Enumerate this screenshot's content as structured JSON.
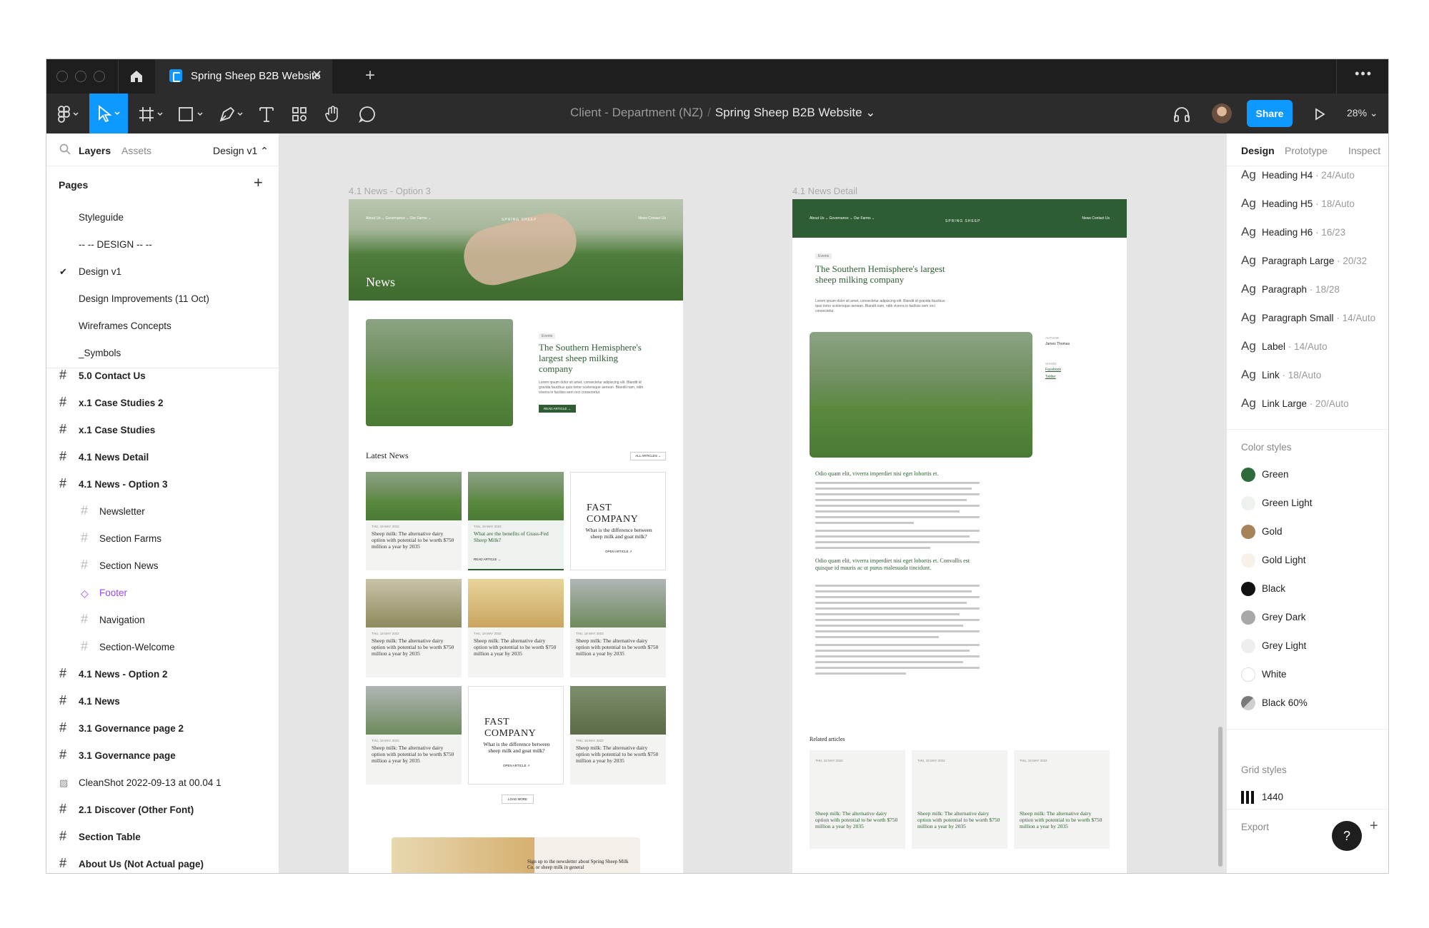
{
  "tabbar": {
    "file_tab": "Spring Sheep B2B Website",
    "close": "✕",
    "new_tab": "+",
    "more": "•••"
  },
  "toolbar": {
    "breadcrumb_team": "Client - Department (NZ)",
    "breadcrumb_sep": "/",
    "breadcrumb_file": "Spring Sheep B2B Website ⌄",
    "share": "Share",
    "zoom": "28% ⌄"
  },
  "left": {
    "tab_layers": "Layers",
    "tab_assets": "Assets",
    "page_selector": "Design v1 ⌃",
    "pages_title": "Pages",
    "pages": [
      "Styleguide",
      "-- -- DESIGN -- --",
      "Design v1",
      "Design Improvements (11 Oct)",
      "Wireframes Concepts",
      "_Symbols"
    ],
    "layers": [
      "5.0 Contact Us",
      "x.1 Case Studies 2",
      "x.1 Case Studies",
      "4.1 News Detail",
      "4.1 News - Option 3",
      "Newsletter",
      "Section Farms",
      "Section News",
      "Footer",
      "Navigation",
      "Section-Welcome",
      "4.1 News - Option 2",
      "4.1 News",
      "3.1 Governance page 2",
      "3.1 Governance page",
      "CleanShot 2022-09-13 at 00.04 1",
      "2.1 Discover (Other Font)",
      "Section Table",
      "About Us (Not Actual page)"
    ]
  },
  "canvas": {
    "frame1_label": "4.1 News - Option 3",
    "frame2_label": "4.1 News Detail",
    "nav_left": "About Us ⌄   Governance ⌄   Our Farms ⌄",
    "nav_right": "News   Contact Us",
    "brand": "SPRING SHEEP",
    "hero_title": "News",
    "feature_tag": "Events",
    "feature_title": "The Southern Hemisphere's largest sheep milking company",
    "feature_body": "Lorem ipsum dolor sit amet, consectetur adipiscing elit. Blandit id gravida faucibus quis tortor scelerisque aenean. Blandit nam, nibh viverra in facilisis sem orci consectetur.",
    "feature_btn": "READ ARTICLE →",
    "latest_news": "Latest News",
    "all_articles": "ALL ARTICLES ⌄",
    "card_date": "THU, 19 MAY 2022",
    "card_text": "Sheep milk: The alternative dairy option with potential to be worth $750 million a year by 2035",
    "card2_text": "What are the benefits of Grass-Fed Sheep Milk?",
    "card2_link": "READ ARTICLE →",
    "fastco": "FAST COMPANY",
    "fastco_text": "What is the difference between sheep milk and goat milk?",
    "fastco_link": "OPEN ARTICLE ↗",
    "load_more": "LOAD MORE",
    "newsletter": "Sign up to the newsletter about Spring Sheep Milk Co. or sheep milk in general",
    "detail_title": "The Southern Hemisphere's largest sheep milking company",
    "detail_intro": "Lorem ipsum dolor sit amet, consectetur adipiscing elit. Blandit id gravida faucibus quis tortor scelerisque aenean. Blandit nam, nibh viverra in facilisis sem orci consectetur.",
    "author_label": "AUTHOR",
    "author_name": "James Thomas",
    "share_label": "SHARE",
    "share_fb": "Facebook",
    "share_tw": "Twitter",
    "sub1": "Odio quam elit, viverra imperdiet nisi eget lobortis et.",
    "sub2": "Odio quam elit, viverra imperdiet nisi eget lobortis et. Convallis est quisque id mauris ac ut purus malesuada tincidunt.",
    "related": "Related articles"
  },
  "right": {
    "tabs": [
      "Design",
      "Prototype",
      "Inspect"
    ],
    "ag": "Ag",
    "text_styles": [
      {
        "name": "Heading H4",
        "size": "· 24/Auto"
      },
      {
        "name": "Heading H5",
        "size": "· 18/Auto"
      },
      {
        "name": "Heading H6",
        "size": "· 16/23"
      },
      {
        "name": "Paragraph Large",
        "size": "· 20/32"
      },
      {
        "name": "Paragraph",
        "size": "· 18/28"
      },
      {
        "name": "Paragraph Small",
        "size": "· 14/Auto"
      },
      {
        "name": "Label",
        "size": "· 14/Auto"
      },
      {
        "name": "Link",
        "size": "· 18/Auto"
      },
      {
        "name": "Link Large",
        "size": "· 20/Auto"
      }
    ],
    "color_styles_title": "Color styles",
    "colors": [
      {
        "name": "Green",
        "hex": "#2f6b3a"
      },
      {
        "name": "Green Light",
        "hex": "#eef2ee"
      },
      {
        "name": "Gold",
        "hex": "#a7835a"
      },
      {
        "name": "Gold Light",
        "hex": "#f7f1ea"
      },
      {
        "name": "Black",
        "hex": "#111111"
      },
      {
        "name": "Grey Dark",
        "hex": "#a8a8a8"
      },
      {
        "name": "Grey Light",
        "hex": "#eeeeee"
      },
      {
        "name": "White",
        "hex": "#ffffff"
      },
      {
        "name": "Black 60%",
        "hex": "#7a7a7a"
      }
    ],
    "grid_styles_title": "Grid styles",
    "grid_value": "1440",
    "export": "Export",
    "help": "?"
  }
}
